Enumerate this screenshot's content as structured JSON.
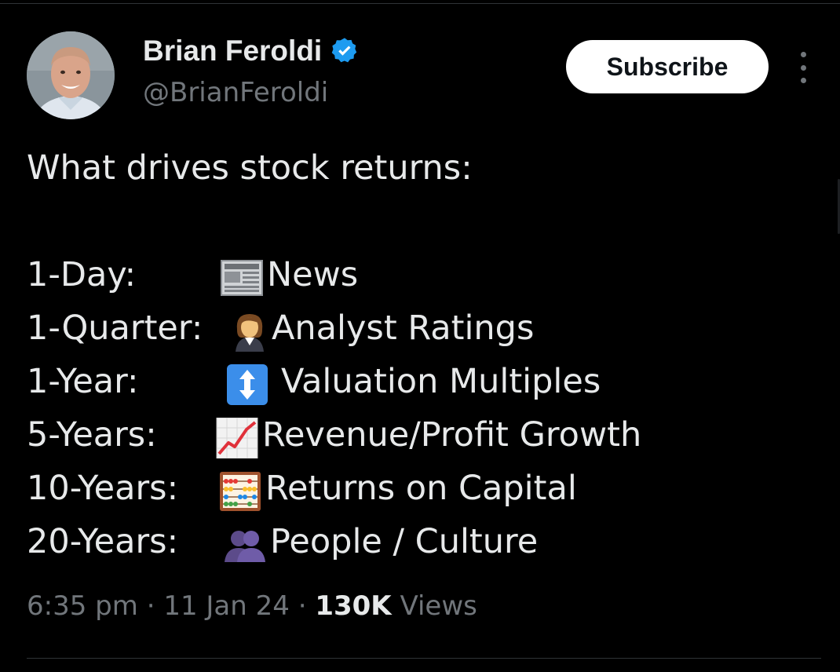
{
  "author": {
    "name": "Brian Feroldi",
    "handle": "@BrianFeroldi",
    "verified": true
  },
  "actions": {
    "subscribe_label": "Subscribe",
    "more_icon": "more-vertical-icon"
  },
  "tweet": {
    "intro": "What drives stock returns:",
    "items": [
      {
        "label": "1-Day:",
        "icon": "newspaper-icon",
        "value": "News"
      },
      {
        "label": "1-Quarter:",
        "icon": "woman-office-worker-icon",
        "value": "Analyst Ratings"
      },
      {
        "label": "1-Year:",
        "icon": "up-down-arrow-icon",
        "value": "Valuation Multiples"
      },
      {
        "label": "5-Years:",
        "icon": "chart-increasing-icon",
        "value": "Revenue/Profit Growth"
      },
      {
        "label": "10-Years:",
        "icon": "abacus-icon",
        "value": "Returns on Capital"
      },
      {
        "label": "20-Years:",
        "icon": "busts-in-silhouette-icon",
        "value": "People / Culture"
      }
    ]
  },
  "meta": {
    "time": "6:35 pm",
    "separator": "·",
    "date": "11 Jan 24",
    "views_count": "130K",
    "views_label": "Views"
  },
  "colors": {
    "background": "#000000",
    "text": "#e7e9ea",
    "secondary_text": "#71767b",
    "verified_blue": "#1d9bf0",
    "button_bg": "#ffffff"
  }
}
